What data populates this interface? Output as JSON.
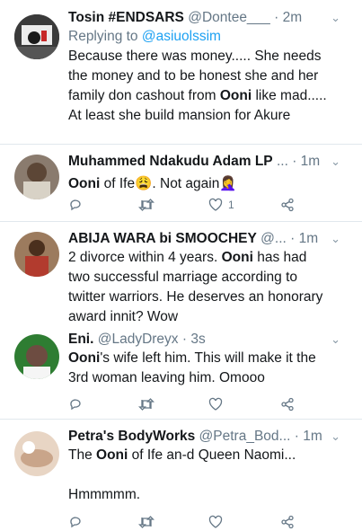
{
  "colors": {
    "link": "#1da1f2",
    "muted": "#657786",
    "text": "#14171a",
    "divider": "#e1e8ed"
  },
  "tweets": [
    {
      "name": "Tosin #ENDSARS",
      "handle": "@Dontee___",
      "time": "· 2m",
      "reply_prefix": "Replying to ",
      "reply_to": "@asiuolssim",
      "lines": [
        "Because there was money..... She needs",
        "the money and to be honest she and her",
        "family don cashout from ",
        "Ooni",
        " like mad.....",
        "At least she build mansion for Akure"
      ]
    },
    {
      "name": "Muhammed Ndakudu Adam LP",
      "handle": "...",
      "time": "· 1m",
      "text_bold": "Ooni",
      "text_rest": " of Ife😩. Not again🤦‍♀️",
      "like_count": "1"
    },
    {
      "name": "ABIJA WARA bi SMOOCHEY",
      "handle": "@...",
      "time": "· 1m",
      "lines": [
        "2 divorce within 4 years. ",
        "Ooni",
        " has had",
        "two successful marriage according to",
        "twitter warriors. He deserves an honorary",
        "award innit? Wow"
      ]
    },
    {
      "name": "Eni.",
      "handle": "@LadyDreyx",
      "time": "· 3s",
      "text_bold": "Ooni",
      "text_rest": "'s wife left him. This will make it the",
      "text_line2": "3rd woman leaving him. Omooo"
    },
    {
      "name": "Petra's BodyWorks",
      "handle": "@Petra_Bod...",
      "time": "· 1m",
      "text_pre": "The ",
      "text_bold": "Ooni",
      "text_rest": " of Ife an-d Queen Naomi...",
      "text_line3": "Hmmmmm."
    }
  ],
  "icons": {
    "reply": "reply-icon",
    "retweet": "retweet-icon",
    "like": "heart-icon",
    "share": "share-icon",
    "caret": "chevron-down-icon"
  }
}
